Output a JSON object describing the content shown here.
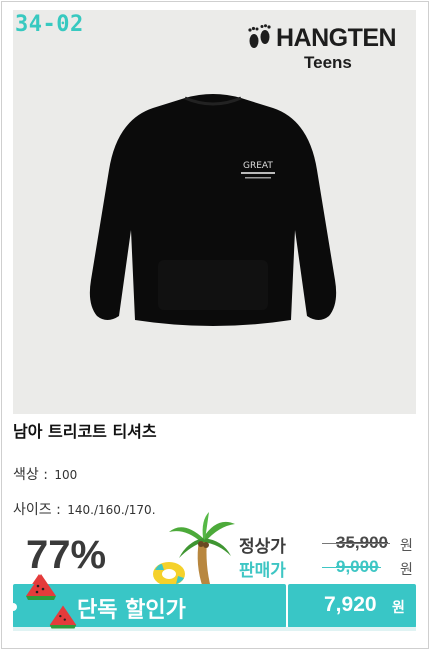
{
  "product": {
    "code": "34-02",
    "brand_name": "HANGTEN",
    "brand_sub": "Teens",
    "title": "남아 트리코트 티셔츠",
    "color_label": "색상 :",
    "color_value": "100",
    "size_label": "사이즈 :",
    "size_value": "140./160./170."
  },
  "pricing": {
    "discount": "77%",
    "regular_label": "정상가",
    "regular_price": "35,900",
    "sale_label": "판매가",
    "sale_price": "9,000",
    "currency": "원"
  },
  "banner": {
    "label": "단독 할인가",
    "price": "7,920",
    "currency": "원"
  },
  "colors": {
    "accent": "#39c6c6",
    "code": "#38c9c0",
    "background": "#ebebe9"
  },
  "icons": [
    "footprint-icon",
    "watermelon-icon",
    "palm-tree-icon",
    "swim-ring-icon"
  ]
}
